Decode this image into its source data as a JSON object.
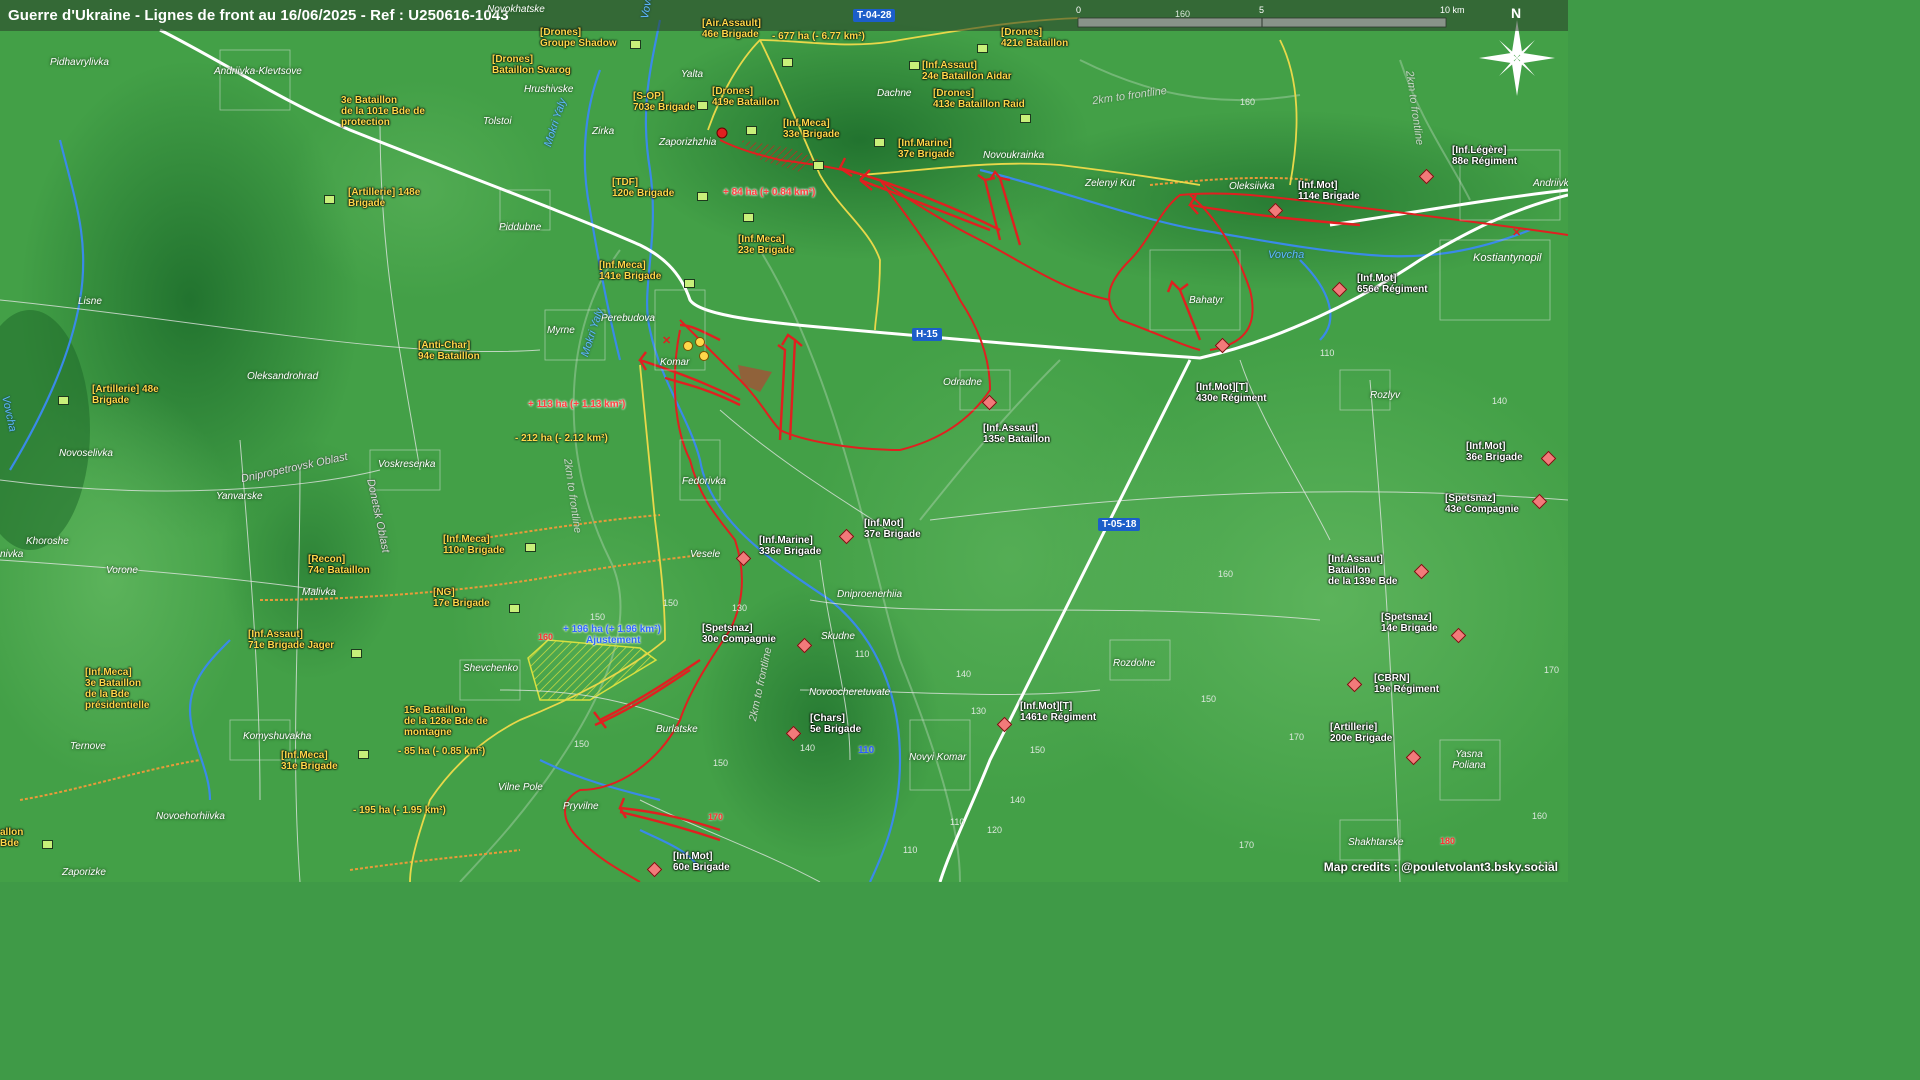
{
  "title": "Guerre d'Ukraine - Lignes de front au 16/06/2025 - Ref : U250616-1043",
  "credits": "Map credits : @pouletvolant3.bsky.social",
  "scale": {
    "labels": [
      "0",
      "5",
      "10 km"
    ]
  },
  "compass": {
    "label": "N",
    "icon": "compass-rose-icon"
  },
  "colors": {
    "ua_unit": "#ffd84a",
    "ru_unit": "#ffffff",
    "front_line": "#e02020",
    "ua_line": "#e8d84a",
    "highway": "#ffffff",
    "river": "#3a8ae8",
    "terrain": "#3f9a47"
  },
  "roads": {
    "t0428": "T-04-28",
    "h15": "H-15",
    "t0518": "T-05-18",
    "r110": "110"
  },
  "places": {
    "novokhatske": "Novokhatske",
    "pidhavrylivka": "Pidhavrylivka",
    "andriivka_klevtsove": "Andriivka-Klevtsove",
    "hrushivske": "Hrushivske",
    "tolstoi": "Tolstoi",
    "zirka": "Zirka",
    "yalta": "Yalta",
    "dachne": "Dachne",
    "zaporizhzhia": "Zaporizhzhia",
    "novoukrainka": "Novoukrainka",
    "zelenyi_kut": "Zelenyi Kut",
    "oleksiivka": "Oleksiivka",
    "andriivka": "Andriivk",
    "kostiantynopil": "Kostiantynopil",
    "piddubne": "Piddubne",
    "lisne": "Lisne",
    "myrne": "Myrne",
    "perebudova": "Perebudova",
    "komar": "Komar",
    "bahatyr": "Bahatyr",
    "oleksandrohrad": "Oleksandrohrad",
    "odradne": "Odradne",
    "rozlyv": "Rozlyv",
    "novoselivka": "Novoselivka",
    "voskresenka": "Voskresenka",
    "yanvarske": "Yanvarske",
    "fedorivka": "Fedorivka",
    "khoroshe": "Khoroshe",
    "vorone": "Vorone",
    "malivka": "Malivka",
    "vesele": "Vesele",
    "dniproenerhiia": "Dniproenerhiia",
    "skudne": "Skudne",
    "shevchenko": "Shevchenko",
    "novoocheretuvate": "Novoocheretuvate",
    "rozdolne": "Rozdolne",
    "komyshuvakha": "Komyshuvakha",
    "ternove": "Ternove",
    "burlatske": "Burlatske",
    "vilne_pole": "Vilne Pole",
    "pryvilne": "Pryvilne",
    "novyi_komar": "Novyi Komar",
    "novoehorhiivka": "Novoehorhiivka",
    "zaporizke": "Zaporizke",
    "shakhtarske": "Shakhtarske",
    "yasna_poliana": "Yasna Poliana",
    "nivka": "nivka"
  },
  "rivers": {
    "vovcha_n": "Vovcha",
    "vovcha_e": "Vovcha",
    "vovcha_w": "Vovcha",
    "mokri_yaly_1": "Mokri Yaly",
    "mokri_yaly_2": "Mokri Yaly"
  },
  "oblasts": {
    "dnipro": "Dnipropetrovsk Oblast",
    "donetsk": "Donetsk Oblast"
  },
  "front_labels": {
    "f1": "2km to frontline",
    "f2": "2km to frontline",
    "f3": "2km to frontline",
    "f4": "2km to frontline"
  },
  "changes": {
    "c1": "- 677 ha (- 6.77 km²)",
    "c2": "+ 84 ha (+ 0.84 km²)",
    "c3": "+ 113 ha (+ 1.13 km²)",
    "c4": "- 212 ha (- 2.12 km²)",
    "c5a": "+ 196 ha (+ 1.96 km²)",
    "c5b": "Ajustement",
    "c6": "- 85 ha (- 0.85 km²)",
    "c7": "- 195 ha (- 1.95 km²)"
  },
  "elevations": {
    "e1": "160",
    "e2": "160",
    "e3": "110",
    "e4": "140",
    "e5": "160",
    "e6": "170",
    "e7": "150",
    "e8": "150",
    "e9": "140",
    "e10": "130",
    "e11": "110",
    "e12": "150",
    "e13": "150",
    "e14": "130",
    "e15": "140",
    "e16": "110",
    "e17": "120",
    "e18": "150",
    "e19": "170",
    "e20": "170",
    "e21": "160",
    "e22": "130",
    "e23": "110",
    "e24": "150",
    "e25": "140"
  },
  "elevations_red": {
    "r1": "160",
    "r2": "170",
    "r3": "180"
  },
  "ua_units": [
    {
      "id": "u1",
      "text": "[Air.Assault]\n46e Brigade"
    },
    {
      "id": "u2",
      "text": "[Drones]\nGroupe Shadow"
    },
    {
      "id": "u3",
      "text": "[Drones]\nBataillon Svarog"
    },
    {
      "id": "u4",
      "text": "[Drones]\n421e Bataillon"
    },
    {
      "id": "u5",
      "text": "[Inf.Assaut]\n24e Bataillon Aidar"
    },
    {
      "id": "u6",
      "text": "[Drones]\n413e Bataillon Raid"
    },
    {
      "id": "u7",
      "text": "3e Bataillon\nde la 101e Bde de\nprotection"
    },
    {
      "id": "u8",
      "text": "[S-OP]\n703e Brigade"
    },
    {
      "id": "u9",
      "text": "[Drones]\n419e Bataillon"
    },
    {
      "id": "u10",
      "text": "[Inf.Meca]\n33e Brigade"
    },
    {
      "id": "u11",
      "text": "[Inf.Marine]\n37e Brigade"
    },
    {
      "id": "u12",
      "text": "[Artillerie] 148e\nBrigade"
    },
    {
      "id": "u13",
      "text": "[TDF]\n120e Brigade"
    },
    {
      "id": "u14",
      "text": "[Inf.Meca]\n23e Brigade"
    },
    {
      "id": "u15",
      "text": "[Inf.Meca]\n141e Brigade"
    },
    {
      "id": "u16",
      "text": "[Anti-Char]\n94e Bataillon"
    },
    {
      "id": "u17",
      "text": "[Artillerie] 48e\nBrigade"
    },
    {
      "id": "u18",
      "text": "[Inf.Meca]\n110e Brigade"
    },
    {
      "id": "u19",
      "text": "[Recon]\n74e Bataillon"
    },
    {
      "id": "u20",
      "text": "[NG]\n17e Brigade"
    },
    {
      "id": "u21",
      "text": "[Inf.Assaut]\n71e Brigade Jager"
    },
    {
      "id": "u22",
      "text": "[Inf.Meca]\n3e Bataillon\nde la Bde\nprésidentielle"
    },
    {
      "id": "u23",
      "text": "15e Bataillon\nde la 128e Bde de\nmontagne"
    },
    {
      "id": "u24",
      "text": "[Inf.Meca]\n31e Brigade"
    },
    {
      "id": "u25",
      "text": "allon\nBde"
    }
  ],
  "ru_units": [
    {
      "id": "r1",
      "text": "[Inf.Légère]\n88e Régiment"
    },
    {
      "id": "r2",
      "text": "[Inf.Mot]\n114e Brigade"
    },
    {
      "id": "r3",
      "text": "[Inf.Mot]\n656e Régiment"
    },
    {
      "id": "r4",
      "text": "[Inf.Mot][T]\n430e Régiment"
    },
    {
      "id": "r5",
      "text": "[Inf.Assaut]\n135e Bataillon"
    },
    {
      "id": "r6",
      "text": "[Inf.Mot]\n36e Brigade"
    },
    {
      "id": "r7",
      "text": "[Spetsnaz]\n43e Compagnie"
    },
    {
      "id": "r8",
      "text": "[Inf.Mot]\n37e Brigade"
    },
    {
      "id": "r9",
      "text": "[Inf.Marine]\n336e Brigade"
    },
    {
      "id": "r10",
      "text": "[Inf.Assaut]\nBataillon\nde la 139e Bde"
    },
    {
      "id": "r11",
      "text": "[Spetsnaz]\n14e Brigade"
    },
    {
      "id": "r12",
      "text": "[Spetsnaz]\n30e Compagnie"
    },
    {
      "id": "r13",
      "text": "[CBRN]\n19e Régiment"
    },
    {
      "id": "r14",
      "text": "[Inf.Mot][T]\n1461e Régiment"
    },
    {
      "id": "r15",
      "text": "[Chars]\n5e Brigade"
    },
    {
      "id": "r16",
      "text": "[Artillerie]\n200e Brigade"
    },
    {
      "id": "r17",
      "text": "[Inf.Mot]\n60e Brigade"
    }
  ]
}
